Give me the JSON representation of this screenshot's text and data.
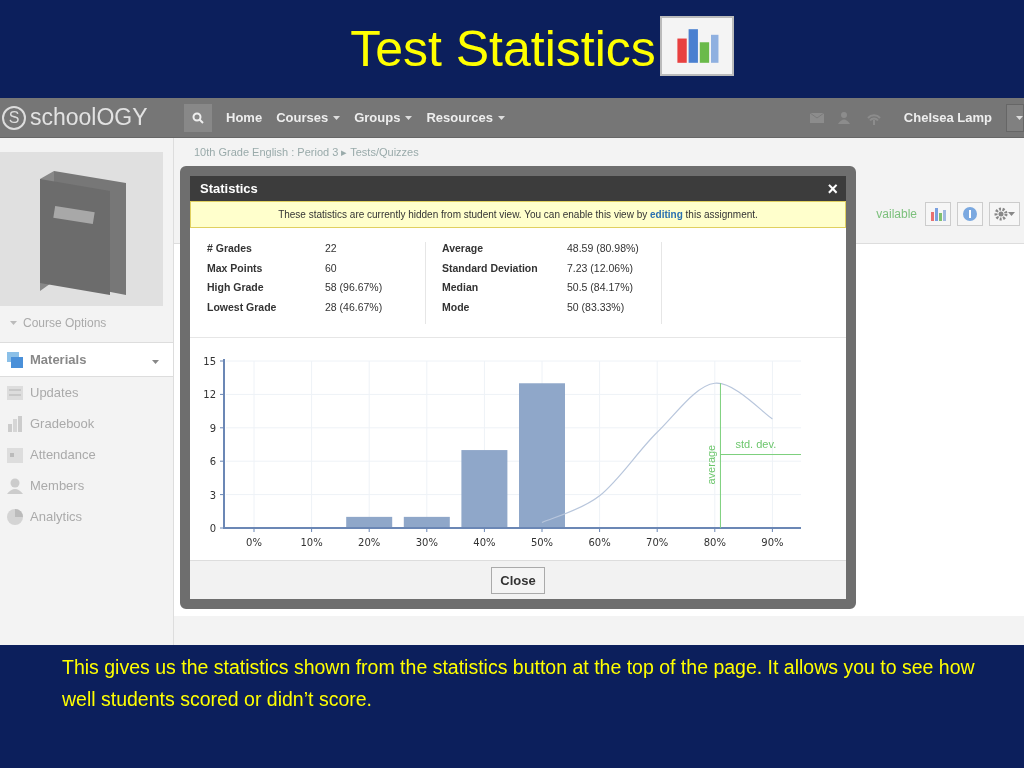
{
  "slide": {
    "title": "Test Statistics",
    "caption": "This gives us the statistics shown from the statistics button at the top of the page. It allows you to see how well students scored or didn’t score."
  },
  "nav": {
    "logo_mark": "S",
    "logo": "schoolOGY",
    "items": [
      {
        "label": "Home",
        "dropdown": false
      },
      {
        "label": "Courses",
        "dropdown": true
      },
      {
        "label": "Groups",
        "dropdown": true
      },
      {
        "label": "Resources",
        "dropdown": true
      }
    ],
    "user": "Chelsea Lamp"
  },
  "sidebar": {
    "course_options": "Course Options",
    "items": [
      {
        "label": "Materials",
        "selected": true
      },
      {
        "label": "Updates",
        "selected": false
      },
      {
        "label": "Gradebook",
        "selected": false
      },
      {
        "label": "Attendance",
        "selected": false
      },
      {
        "label": "Members",
        "selected": false
      },
      {
        "label": "Analytics",
        "selected": false
      }
    ]
  },
  "page": {
    "breadcrumb": "10th Grade English : Period 3 ▸ Tests/Quizzes",
    "status": "vailable"
  },
  "modal": {
    "title": "Statistics",
    "close": "×",
    "notice": {
      "before": "These statistics are currently hidden from student view. You can enable this view by ",
      "link": "editing",
      "after": " this assignment."
    },
    "stats_left": [
      {
        "label": "# Grades",
        "value": "22"
      },
      {
        "label": "Max Points",
        "value": "60"
      },
      {
        "label": "High Grade",
        "value": "58 (96.67%)"
      },
      {
        "label": "Lowest Grade",
        "value": "28 (46.67%)"
      }
    ],
    "stats_right": [
      {
        "label": "Average",
        "value": "48.59 (80.98%)"
      },
      {
        "label": "Standard Deviation",
        "value": "7.23 (12.06%)"
      },
      {
        "label": "Median",
        "value": "50.5 (84.17%)"
      },
      {
        "label": "Mode",
        "value": "50 (83.33%)"
      }
    ],
    "chart_data": {
      "type": "bar",
      "categories": [
        "0%",
        "10%",
        "20%",
        "30%",
        "40%",
        "50%",
        "60%",
        "70%",
        "80%",
        "90%"
      ],
      "series": [
        {
          "type": "bar",
          "color": "#8fa7c9",
          "values": [
            0,
            0,
            1,
            1,
            7,
            13,
            0,
            0,
            0,
            0
          ]
        },
        {
          "type": "line",
          "color": "#b8c6dc",
          "values": [
            null,
            null,
            null,
            null,
            null,
            0.5,
            2.9,
            8.6,
            13,
            9.8
          ]
        }
      ],
      "grid": true,
      "ylim": [
        0,
        15
      ],
      "yticks": [
        0,
        3,
        6,
        9,
        12,
        15
      ],
      "annotations": [
        {
          "text": "average"
        },
        {
          "text": "std. dev."
        }
      ]
    },
    "button": "Close"
  }
}
